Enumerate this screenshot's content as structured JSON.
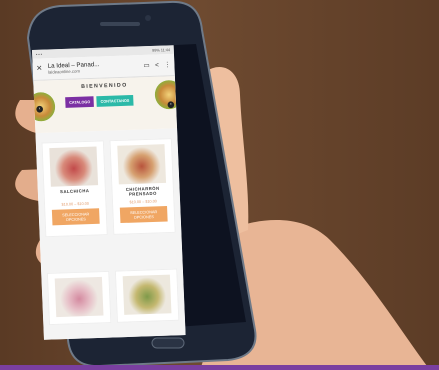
{
  "colors": {
    "catalog": "#7b2fa3",
    "contact": "#2bb9a8",
    "select": "#f0a663",
    "price": "#e29a6a",
    "band": "#7a3fa0"
  },
  "status": {
    "time": "11:44",
    "battery": "99%"
  },
  "browser": {
    "title": "La Ideal – Panad...",
    "url": "laideaonline.com"
  },
  "hero": {
    "welcome": "BIENVENIDO",
    "catalog_btn": "CATALOGO",
    "contact_btn": "CONTACTANOS"
  },
  "products": [
    {
      "name": "SALCHICHA",
      "price": "$10.00 – $10.00",
      "button": "SELECCIONAR OPCIONES"
    },
    {
      "name": "CHICHARRÓN PRENSADO",
      "price": "$10.00 – $10.00",
      "button": "SELECCIONAR OPCIONES"
    },
    {
      "name": "",
      "price": "",
      "button": ""
    },
    {
      "name": "",
      "price": "",
      "button": ""
    }
  ]
}
